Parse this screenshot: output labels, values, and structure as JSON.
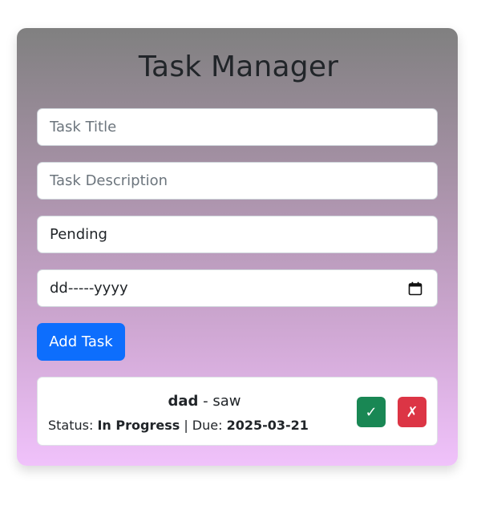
{
  "app": {
    "title": "Task Manager"
  },
  "form": {
    "title_placeholder": "Task Title",
    "description_placeholder": "Task Description",
    "status_value": "Pending",
    "date_placeholder": "dd-----yyyy",
    "add_button_label": "Add Task"
  },
  "tasks": [
    {
      "title": "dad",
      "separator": " - ",
      "description": "saw",
      "status_label": "Status: ",
      "status": "In Progress",
      "due_separator": " | Due: ",
      "due": "2025-03-21",
      "complete_icon": "✓",
      "delete_icon": "✗"
    }
  ],
  "colors": {
    "primary": "#0d6efd",
    "success": "#198754",
    "danger": "#dc3545",
    "gradient_top": "#808080",
    "gradient_bottom": "#f0c2fb"
  }
}
